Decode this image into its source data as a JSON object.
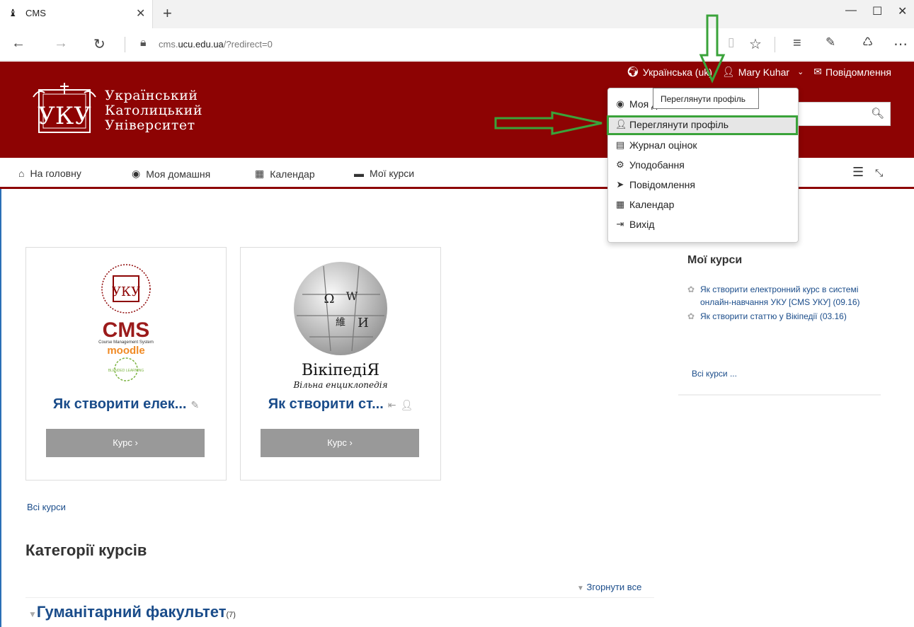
{
  "browser": {
    "tab_title": "CMS",
    "url_prefix": "cms.",
    "url_domain": "ucu.edu.ua",
    "url_path": "/?redirect=0"
  },
  "header": {
    "logo_line1": "Український",
    "logo_line2": "Католицький",
    "logo_line3": "Університет",
    "language": "Українська (uk)",
    "user_name": "Mary Kuhar",
    "messages": "Повідомлення",
    "search_placeholder": ""
  },
  "nav": {
    "home": "На головну",
    "dashboard": "Моя домашня",
    "calendar": "Календар",
    "my_courses": "Мої курси"
  },
  "user_menu": {
    "tooltip": "Переглянути профіль",
    "items": [
      {
        "label": "Моя домашня",
        "icon": "dashboard-icon"
      },
      {
        "label": "Переглянути профіль",
        "icon": "user-icon"
      },
      {
        "label": "Журнал оцінок",
        "icon": "grades-icon"
      },
      {
        "label": "Уподобання",
        "icon": "gear-icon"
      },
      {
        "label": "Повідомлення",
        "icon": "paper-plane-icon"
      },
      {
        "label": "Календар",
        "icon": "calendar-icon"
      },
      {
        "label": "Вихід",
        "icon": "logout-icon"
      }
    ]
  },
  "courses": [
    {
      "title": "Як створити елек...",
      "button": "Курс ›",
      "logo_cms": "CMS",
      "logo_sub": "Course Management System",
      "logo_moodle": "moodle",
      "logo_blended": "BLENDED LEARNING"
    },
    {
      "title": "Як створити ст...",
      "button": "Курс ›",
      "wiki_name": "ВікіпедіЯ",
      "wiki_tagline": "Вільна енциклопедія"
    }
  ],
  "my_courses_block": {
    "title": "Мої курси",
    "items": [
      "Як створити електронний курс в системі онлайн-навчання УКУ [CMS УКУ] (09.16)",
      "Як створити статтю у Вікіпедії (03.16)"
    ],
    "all": "Всі курси ..."
  },
  "content": {
    "all_courses": "Всі курси",
    "categories_title": "Категорії курсів",
    "collapse_all": "Згорнути все",
    "category_name": "Гуманітарний факультет",
    "category_count": "(7)"
  },
  "colors": {
    "brand": "#8d0303",
    "link": "#1a4c8a",
    "highlight": "#3aa33a"
  }
}
